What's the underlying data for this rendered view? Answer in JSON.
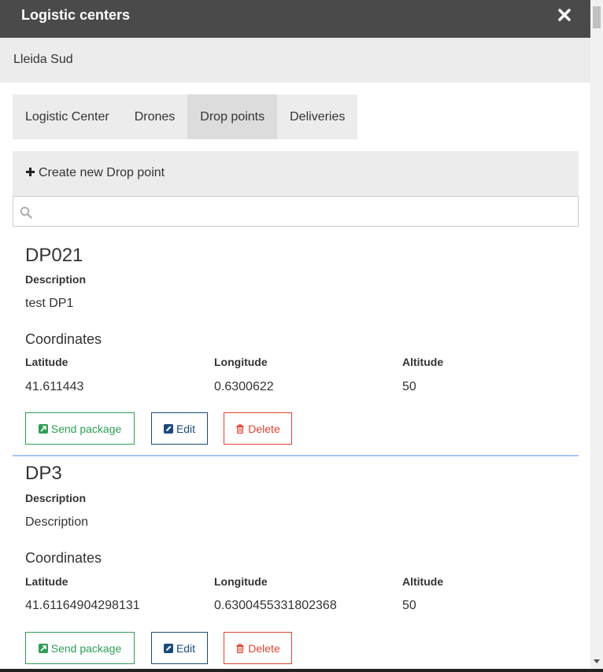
{
  "dialog": {
    "title": "Logistic centers",
    "center_name": "Lleida Sud"
  },
  "tabs": [
    {
      "label": "Logistic Center",
      "active": false
    },
    {
      "label": "Drones",
      "active": false
    },
    {
      "label": "Drop points",
      "active": true
    },
    {
      "label": "Deliveries",
      "active": false
    }
  ],
  "create_button": {
    "label": "Create new Drop point",
    "icon": "plus-icon"
  },
  "search": {
    "value": "",
    "placeholder": "",
    "icon": "search-icon"
  },
  "labels": {
    "description": "Description",
    "coordinates": "Coordinates",
    "latitude": "Latitude",
    "longitude": "Longitude",
    "altitude": "Altitude",
    "send_package": "Send package",
    "edit": "Edit",
    "delete": "Delete"
  },
  "drop_points": [
    {
      "name": "DP021",
      "description": "test DP1",
      "latitude": "41.611443",
      "longitude": "0.6300622",
      "altitude": "50"
    },
    {
      "name": "DP3",
      "description": "Description",
      "latitude": "41.61164904298131",
      "longitude": "0.6300455331802368",
      "altitude": "50"
    }
  ],
  "colors": {
    "titlebar": "#4a4a4a",
    "send_package": "#2e9e55",
    "edit": "#1a4a7a",
    "delete": "#e0432f",
    "separator": "#a8c4ff"
  }
}
